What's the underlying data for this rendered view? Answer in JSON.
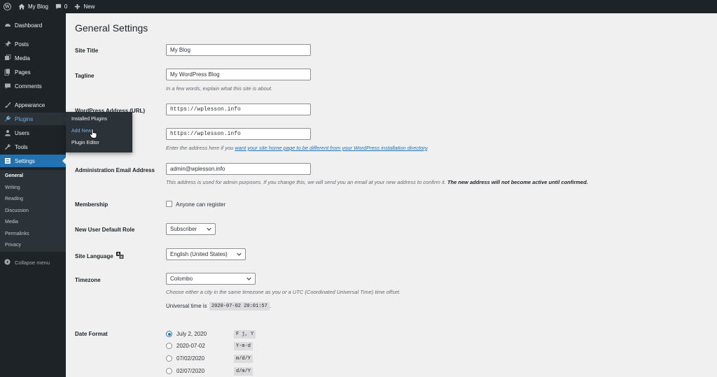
{
  "adminbar": {
    "site_name": "My Blog",
    "comments_count": "0",
    "new_label": "New"
  },
  "sidebar": {
    "items": [
      {
        "label": "Dashboard",
        "icon": "dashboard-icon"
      },
      {
        "label": "Posts",
        "icon": "pin-icon"
      },
      {
        "label": "Media",
        "icon": "media-icon"
      },
      {
        "label": "Pages",
        "icon": "pages-icon"
      },
      {
        "label": "Comments",
        "icon": "comment-icon"
      },
      {
        "label": "Appearance",
        "icon": "brush-icon"
      },
      {
        "label": "Plugins",
        "icon": "plugin-icon"
      },
      {
        "label": "Users",
        "icon": "user-icon"
      },
      {
        "label": "Tools",
        "icon": "wrench-icon"
      },
      {
        "label": "Settings",
        "icon": "settings-icon"
      }
    ],
    "settings_submenu": [
      "General",
      "Writing",
      "Reading",
      "Discussion",
      "Media",
      "Permalinks",
      "Privacy"
    ],
    "collapse_label": "Collapse menu"
  },
  "plugins_flyout": {
    "items": [
      "Installed Plugins",
      "Add New",
      "Plugin Editor"
    ]
  },
  "page": {
    "title": "General Settings",
    "site_title": {
      "label": "Site Title",
      "value": "My Blog"
    },
    "tagline": {
      "label": "Tagline",
      "value": "My WordPress Blog",
      "description": "In a few words, explain what this site is about."
    },
    "wp_address": {
      "label": "WordPress Address (URL)",
      "value": "https://wplesson.info"
    },
    "site_address": {
      "value": "https://wplesson.info",
      "desc_before": "Enter the address here if you ",
      "desc_link": "want your site home page to be different from your WordPress installation directory",
      "desc_after": "."
    },
    "admin_email": {
      "label": "Administration Email Address",
      "value": "admin@wplesson.info",
      "desc": "This address is used for admin purposes. If you change this, we will send you an email at your new address to confirm it. ",
      "desc_bold": "The new address will not become active until confirmed."
    },
    "membership": {
      "label": "Membership",
      "checkbox_label": "Anyone can register",
      "checked": false
    },
    "default_role": {
      "label": "New User Default Role",
      "value": "Subscriber"
    },
    "site_language": {
      "label": "Site Language",
      "value": "English (United States)",
      "icon": "translate-icon"
    },
    "timezone": {
      "label": "Timezone",
      "value": "Colombo",
      "description": "Choose either a city in the same timezone as you or a UTC (Coordinated Universal Time) time offset.",
      "universal_label": "Universal time is",
      "universal_value": "2020-07-02 20:01:57",
      "universal_after": "."
    },
    "date_format": {
      "label": "Date Format",
      "options": [
        {
          "label": "July 2, 2020",
          "code": "F j, Y",
          "checked": true
        },
        {
          "label": "2020-07-02",
          "code": "Y-m-d",
          "checked": false
        },
        {
          "label": "07/02/2020",
          "code": "m/d/Y",
          "checked": false
        },
        {
          "label": "02/07/2020",
          "code": "d/m/Y",
          "checked": false
        }
      ]
    }
  }
}
